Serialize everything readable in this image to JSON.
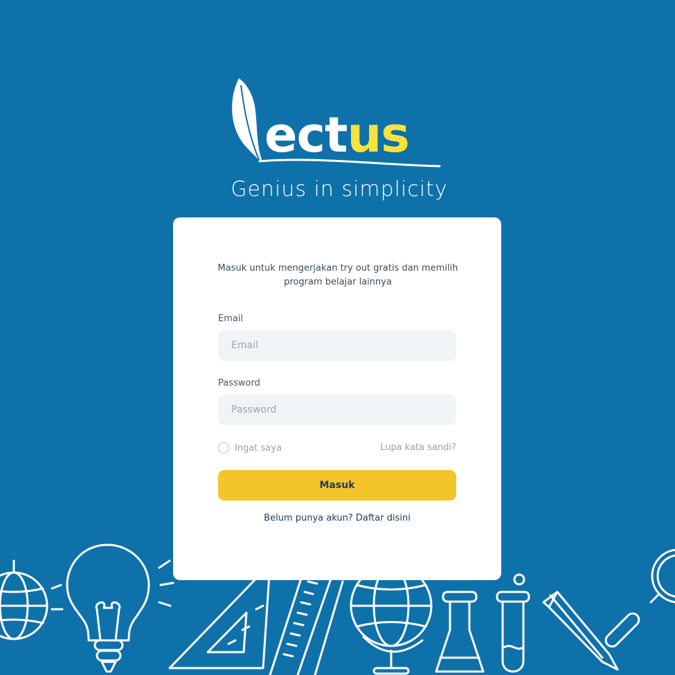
{
  "brand": {
    "wordmark_white": "ect",
    "wordmark_yellow": "us",
    "tagline": "Genius in simplicity",
    "colors": {
      "background": "#0f71a9",
      "accent_yellow": "#f9e23b",
      "button": "#f4c52a",
      "button_text": "#213a63"
    }
  },
  "login": {
    "intro": "Masuk untuk mengerjakan try out gratis dan memilih program belajar lainnya",
    "email_label": "Email",
    "email_placeholder": "Email",
    "password_label": "Password",
    "password_placeholder": "Password",
    "remember_label": "Ingat saya",
    "forgot_link": "Lupa kata sandi?",
    "submit_label": "Masuk",
    "signup_prompt": "Belum punya akun?",
    "signup_link": "Daftar disini"
  },
  "icons": {
    "logo": "leaf-quill-logo-icon",
    "background": [
      "globe-icon",
      "lightbulb-icon",
      "set-square-icon",
      "ruler-icon",
      "globe-stand-icon",
      "flask-icon",
      "test-tube-icon",
      "pencil-icon",
      "magnifier-icon"
    ]
  }
}
